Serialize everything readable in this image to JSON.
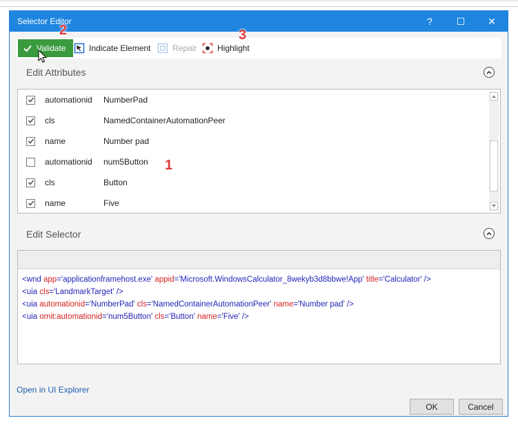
{
  "window": {
    "title": "Selector Editor"
  },
  "titlebar": {
    "help": "?",
    "maximize": "☐",
    "close": "✕"
  },
  "toolbar": {
    "validate_label": "Validate",
    "indicate_label": "Indicate Element",
    "repair_label": "Repair",
    "highlight_label": "Highlight"
  },
  "edit_attributes": {
    "title": "Edit Attributes",
    "rows": [
      {
        "checked": true,
        "name": "automationid",
        "value": "NumberPad"
      },
      {
        "checked": true,
        "name": "cls",
        "value": "NamedContainerAutomationPeer"
      },
      {
        "checked": true,
        "name": "name",
        "value": "Number pad"
      },
      {
        "checked": false,
        "name": "automationid",
        "value": "num5Button"
      },
      {
        "checked": true,
        "name": "cls",
        "value": "Button"
      },
      {
        "checked": true,
        "name": "name",
        "value": "Five"
      }
    ]
  },
  "edit_selector": {
    "title": "Edit Selector",
    "lines": [
      [
        {
          "t": "tag",
          "s": "<wnd "
        },
        {
          "t": "attr",
          "s": "app"
        },
        {
          "t": "eq",
          "s": "="
        },
        {
          "t": "val",
          "s": "'applicationframehost.exe' "
        },
        {
          "t": "attr",
          "s": "appid"
        },
        {
          "t": "eq",
          "s": "="
        },
        {
          "t": "val",
          "s": "'Microsoft.WindowsCalculator_8wekyb3d8bbwe!App' "
        },
        {
          "t": "attr",
          "s": "title"
        },
        {
          "t": "eq",
          "s": "="
        },
        {
          "t": "val",
          "s": "'Calculator' "
        },
        {
          "t": "tag",
          "s": "/>"
        }
      ],
      [
        {
          "t": "tag",
          "s": "<uia "
        },
        {
          "t": "attr",
          "s": "cls"
        },
        {
          "t": "eq",
          "s": "="
        },
        {
          "t": "val",
          "s": "'LandmarkTarget' "
        },
        {
          "t": "tag",
          "s": "/>"
        }
      ],
      [
        {
          "t": "tag",
          "s": "<uia "
        },
        {
          "t": "attr",
          "s": "automationid"
        },
        {
          "t": "eq",
          "s": "="
        },
        {
          "t": "val",
          "s": "'NumberPad' "
        },
        {
          "t": "attr",
          "s": "cls"
        },
        {
          "t": "eq",
          "s": "="
        },
        {
          "t": "val",
          "s": "'NamedContainerAutomationPeer' "
        },
        {
          "t": "attr",
          "s": "name"
        },
        {
          "t": "eq",
          "s": "="
        },
        {
          "t": "val",
          "s": "'Number pad' "
        },
        {
          "t": "tag",
          "s": "/>"
        }
      ],
      [
        {
          "t": "tag",
          "s": "<uia "
        },
        {
          "t": "attr",
          "s": "omit:automationid"
        },
        {
          "t": "eq",
          "s": "="
        },
        {
          "t": "val",
          "s": "'num5Button' "
        },
        {
          "t": "attr",
          "s": "cls"
        },
        {
          "t": "eq",
          "s": "="
        },
        {
          "t": "val",
          "s": "'Button' "
        },
        {
          "t": "attr",
          "s": "name"
        },
        {
          "t": "eq",
          "s": "="
        },
        {
          "t": "val",
          "s": "'Five' "
        },
        {
          "t": "tag",
          "s": "/>"
        }
      ]
    ]
  },
  "footer": {
    "link_label": "Open in UI Explorer",
    "ok_label": "OK",
    "cancel_label": "Cancel"
  },
  "annotations": {
    "step1": "1",
    "step2": "2",
    "step3": "3"
  },
  "colors": {
    "accent": "#1f86e0",
    "validate": "#3a9a3e",
    "annotation": "#e03a3a"
  }
}
